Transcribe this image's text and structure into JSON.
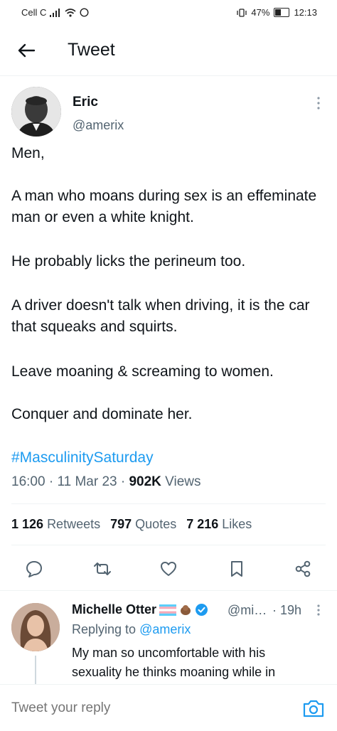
{
  "status": {
    "carrier": "Cell C",
    "battery": "47%",
    "time": "12:13"
  },
  "header": {
    "title": "Tweet"
  },
  "tweet": {
    "author_name": "Eric",
    "author_handle": "@amerix",
    "paragraphs": [
      "Men,",
      "A man who moans during sex is an effeminate man or even a white knight.",
      "He probably licks the perineum too.",
      "A driver doesn't talk when driving, it is the car that squeaks and squirts.",
      "Leave moaning & screaming to women.",
      "Conquer and dominate her."
    ],
    "hashtag": "#MasculinitySaturday",
    "time": "16:00",
    "date": "11 Mar 23",
    "views_count": "902K",
    "views_label": "Views",
    "retweets_count": "1 126",
    "retweets_label": "Retweets",
    "quotes_count": "797",
    "quotes_label": "Quotes",
    "likes_count": "7 216",
    "likes_label": "Likes"
  },
  "reply": {
    "name": "Michelle Otter",
    "handle": "@mi…",
    "time": "· 19h",
    "replying_prefix": "Replying to",
    "replying_to": "@amerix",
    "text": "My man so uncomfortable with his sexuality he thinks moaning while in"
  },
  "composer": {
    "placeholder": "Tweet your reply"
  },
  "colors": {
    "accent": "#1d9bf0",
    "secondary_text": "#536471",
    "primary_text": "#0f1419",
    "verified": "#1d9bf0"
  }
}
